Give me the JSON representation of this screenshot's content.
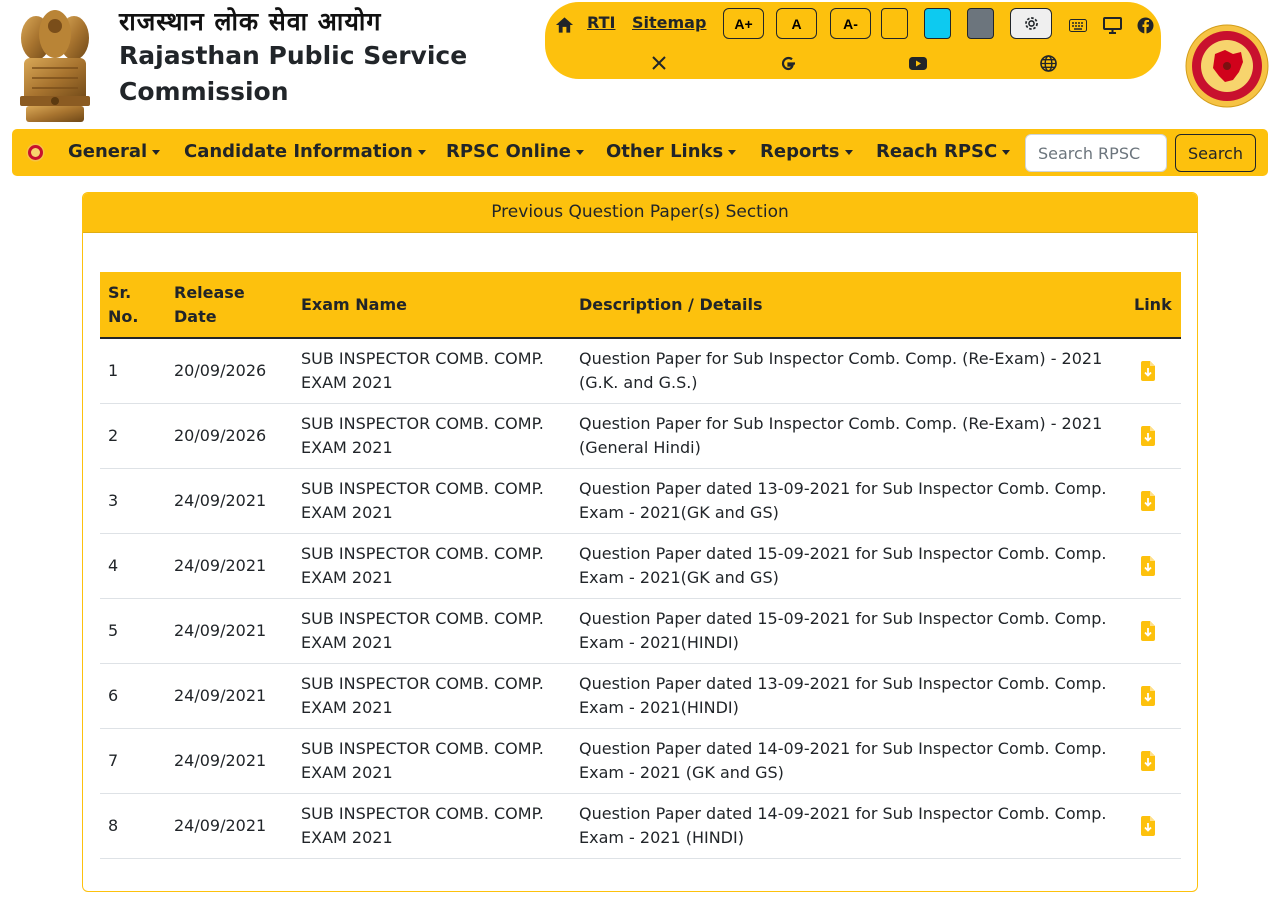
{
  "header": {
    "title_hindi": "राजस्थान लोक सेवा आयोग",
    "title_english": "Rajasthan Public Service Commission"
  },
  "toolbar": {
    "rti_label": "RTI",
    "sitemap_label": "Sitemap",
    "font_increase_label": "A+",
    "font_normal_label": "A",
    "font_decrease_label": "A-",
    "theme_colors": [
      "#fdc10d",
      "#0dcaf0",
      "#6c757d"
    ],
    "icons": [
      "home-icon",
      "settings-icon",
      "keyboard-icon",
      "desktop-icon",
      "facebook-icon",
      "x-icon",
      "google-icon",
      "youtube-icon",
      "globe-icon"
    ]
  },
  "nav": {
    "items": [
      {
        "label": "General"
      },
      {
        "label": "Candidate Information"
      },
      {
        "label": "RPSC Online"
      },
      {
        "label": "Other Links"
      },
      {
        "label": "Reports"
      },
      {
        "label": "Reach RPSC"
      }
    ],
    "search_placeholder": "Search RPSC",
    "search_button": "Search"
  },
  "section": {
    "title": "Previous Question Paper(s) Section",
    "columns": {
      "sr": "Sr. No.",
      "date": "Release Date",
      "exam": "Exam Name",
      "desc": "Description / Details",
      "link": "Link"
    },
    "rows": [
      {
        "sr": "1",
        "date": "20/09/2026",
        "exam": "SUB INSPECTOR COMB. COMP. EXAM 2021",
        "desc": "Question Paper for Sub Inspector Comb. Comp. (Re-Exam) - 2021 (G.K. and G.S.)"
      },
      {
        "sr": "2",
        "date": "20/09/2026",
        "exam": "SUB INSPECTOR COMB. COMP. EXAM 2021",
        "desc": "Question Paper for Sub Inspector Comb. Comp. (Re-Exam) - 2021 (General Hindi)"
      },
      {
        "sr": "3",
        "date": "24/09/2021",
        "exam": "SUB INSPECTOR COMB. COMP. EXAM 2021",
        "desc": "Question Paper dated 13-09-2021 for Sub Inspector Comb. Comp. Exam - 2021(GK and GS)"
      },
      {
        "sr": "4",
        "date": "24/09/2021",
        "exam": "SUB INSPECTOR COMB. COMP. EXAM 2021",
        "desc": "Question Paper dated 15-09-2021 for Sub Inspector Comb. Comp. Exam - 2021(GK and GS)"
      },
      {
        "sr": "5",
        "date": "24/09/2021",
        "exam": "SUB INSPECTOR COMB. COMP. EXAM 2021",
        "desc": "Question Paper dated 15-09-2021 for Sub Inspector Comb. Comp. Exam - 2021(HINDI)"
      },
      {
        "sr": "6",
        "date": "24/09/2021",
        "exam": "SUB INSPECTOR COMB. COMP. EXAM 2021",
        "desc": "Question Paper dated 13-09-2021 for Sub Inspector Comb. Comp. Exam - 2021(HINDI)"
      },
      {
        "sr": "7",
        "date": "24/09/2021",
        "exam": "SUB INSPECTOR COMB. COMP. EXAM 2021",
        "desc": "Question Paper dated 14-09-2021 for Sub Inspector Comb. Comp. Exam - 2021 (GK and GS)"
      },
      {
        "sr": "8",
        "date": "24/09/2021",
        "exam": "SUB INSPECTOR COMB. COMP. EXAM 2021",
        "desc": "Question Paper dated 14-09-2021 for Sub Inspector Comb. Comp. Exam - 2021 (HINDI)"
      }
    ]
  },
  "colors": {
    "accent": "#fdc10d",
    "pdf_icon": "#fdc10d"
  }
}
